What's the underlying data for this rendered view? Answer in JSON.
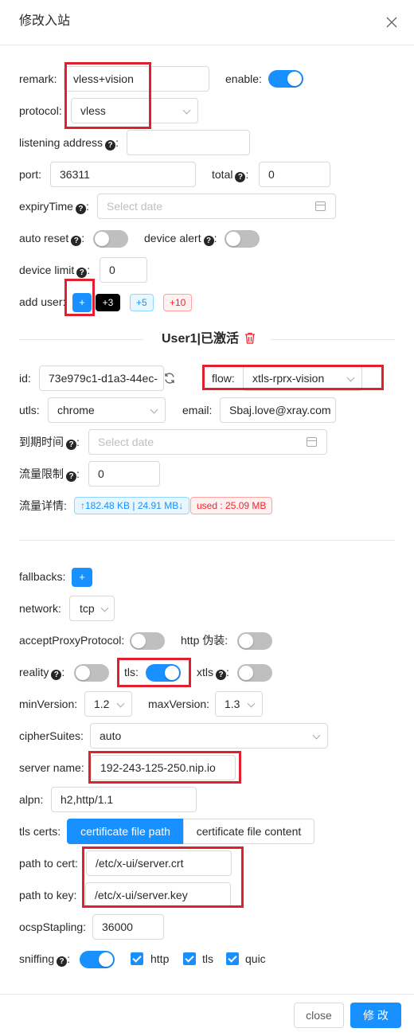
{
  "modal": {
    "title": "修改入站"
  },
  "form": {
    "remark": {
      "label": "remark",
      "value": "vless+vision"
    },
    "enable": {
      "label": "enable",
      "on": true
    },
    "protocol": {
      "label": "protocol",
      "value": "vless"
    },
    "listening_address": {
      "label": "listening address",
      "value": ""
    },
    "port": {
      "label": "port",
      "value": "36311"
    },
    "total": {
      "label": "total",
      "value": "0"
    },
    "expiry": {
      "label": "expiryTime",
      "placeholder": "Select date"
    },
    "auto_reset": {
      "label": "auto reset",
      "on": false
    },
    "device_alert": {
      "label": "device alert",
      "on": false
    },
    "device_limit": {
      "label": "device limit",
      "value": "0"
    },
    "add_user": {
      "label": "add user",
      "plus": "+",
      "b3": "+3",
      "b5": "+5",
      "b10": "+10"
    }
  },
  "user": {
    "title": "User1|已激活",
    "id_label": "id",
    "id_value": "73e979c1-d1a3-44ec-",
    "flow_label": "flow",
    "flow_value": "xtls-rprx-vision",
    "utls_label": "utls",
    "utls_value": "chrome",
    "email_label": "email",
    "email_value": "Sbaj.love@xray.com",
    "expire_label": "到期时间",
    "expire_placeholder": "Select date",
    "limit_label": "流量限制",
    "limit_value": "0",
    "detail_label": "流量详情",
    "traffic_tag": "↑182.48 KB | 24.91 MB↓",
    "used_tag": "used : 25.09 MB"
  },
  "stream": {
    "fallbacks_label": "fallbacks",
    "fallbacks_btn": "+",
    "network_label": "network",
    "network_value": "tcp",
    "accept_proxy_label": "acceptProxyProtocol",
    "accept_proxy_on": false,
    "http_label": "http 伪装",
    "http_on": false,
    "reality_label": "reality",
    "reality_on": false,
    "tls_label": "tls",
    "tls_on": true,
    "xtls_label": "xtls",
    "xtls_on": false,
    "minversion_label": "minVersion",
    "minversion_value": "1.2",
    "maxversion_label": "maxVersion",
    "maxversion_value": "1.3",
    "ciphersuites_label": "cipherSuites",
    "ciphersuites_value": "auto",
    "servername_label": "server name",
    "servername_value": "192-243-125-250.nip.io",
    "alpn_label": "alpn",
    "alpn_value": "h2,http/1.1",
    "certs_label": "tls certs",
    "cert_tab_path": "certificate file path",
    "cert_tab_content": "certificate file content",
    "cert_path_label": "path to cert",
    "cert_path_value": "/etc/x-ui/server.crt",
    "key_path_label": "path to key",
    "key_path_value": "/etc/x-ui/server.key",
    "ocsp_label": "ocspStapling",
    "ocsp_value": "36000",
    "sniffing_label": "sniffing",
    "sniff_http": "http",
    "sniff_tls": "tls",
    "sniff_quic": "quic"
  },
  "footer": {
    "close": "close",
    "submit": "修 改"
  },
  "colors": {
    "primary": "#1890ff",
    "highlight": "#e0202e"
  }
}
